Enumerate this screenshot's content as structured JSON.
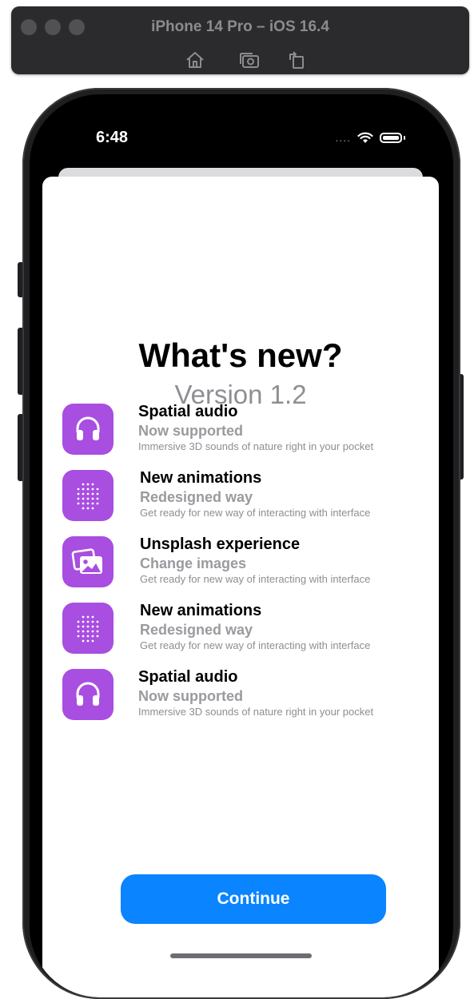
{
  "simulator": {
    "title": "iPhone 14 Pro – iOS 16.4",
    "tools": [
      "home-icon",
      "screenshot-icon",
      "rotate-icon"
    ]
  },
  "status_bar": {
    "time": "6:48",
    "signal": "....",
    "icons": [
      "wifi-icon",
      "battery-icon"
    ]
  },
  "sheet": {
    "title": "What's new?",
    "version": "Version 1.2",
    "accent_color": "#a84ee0",
    "features": [
      {
        "icon": "headphones-icon",
        "title": "Spatial audio",
        "subtitle": "Now supported",
        "description": "Immersive 3D sounds of nature right in your pocket"
      },
      {
        "icon": "dots-grid-icon",
        "title": "New animations",
        "subtitle": "Redesigned way",
        "description": "Get ready for new way of interacting with interface"
      },
      {
        "icon": "photos-icon",
        "title": "Unsplash experience",
        "subtitle": "Change images",
        "description": "Get ready for new way of interacting with interface"
      },
      {
        "icon": "dots-grid-icon",
        "title": "New animations",
        "subtitle": "Redesigned way",
        "description": "Get ready for new way of interacting with interface"
      },
      {
        "icon": "headphones-icon",
        "title": "Spatial audio",
        "subtitle": "Now supported",
        "description": "Immersive 3D sounds of nature right in your pocket"
      }
    ],
    "continue_label": "Continue",
    "button_color": "#0a84ff"
  }
}
